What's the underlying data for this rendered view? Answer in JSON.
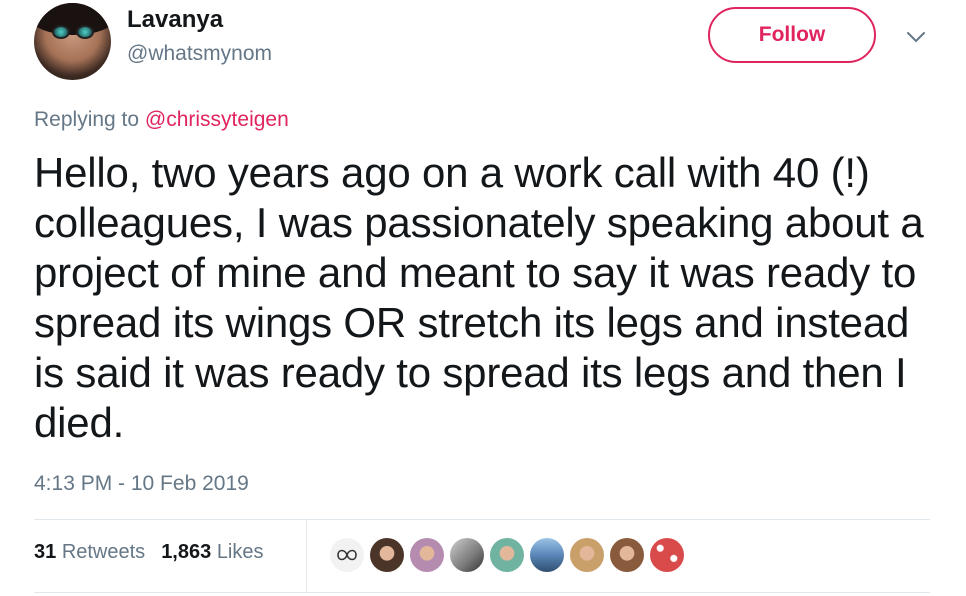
{
  "author": {
    "name": "Lavanya",
    "handle": "@whatsmynom"
  },
  "follow_label": "Follow",
  "reply": {
    "prefix": "Replying to ",
    "target": "@chrissyteigen"
  },
  "tweet_text": "Hello, two years ago on a work call with 40 (!) colleagues, I was passionately speaking about a project of mine and meant to say it was ready to spread its wings OR stretch its legs and instead is said it was ready to spread its legs and then I died.",
  "timestamp": "4:13 PM - 10 Feb 2019",
  "stats": {
    "retweets_count": "31",
    "retweets_label": "Retweets",
    "likes_count": "1,863",
    "likes_label": "Likes"
  },
  "colors": {
    "accent": "#e0245e",
    "secondary_text": "#657786",
    "primary_text": "#14171a",
    "divider": "#e1e8ed"
  },
  "liker_avatars": [
    {
      "style": "infinity-logo",
      "bg": "#f2f2f2"
    },
    {
      "style": "portrait",
      "bg": "#4a3528"
    },
    {
      "style": "portrait",
      "bg": "#b58bb0"
    },
    {
      "style": "grayscale-photo",
      "bg": "#7a7a7a"
    },
    {
      "style": "illustration",
      "bg": "#6fb3a0"
    },
    {
      "style": "landscape",
      "bg": "#5a86b8"
    },
    {
      "style": "portrait",
      "bg": "#c9a06a"
    },
    {
      "style": "portrait",
      "bg": "#8a5a3c"
    },
    {
      "style": "pattern",
      "bg": "#d94a4a"
    }
  ]
}
